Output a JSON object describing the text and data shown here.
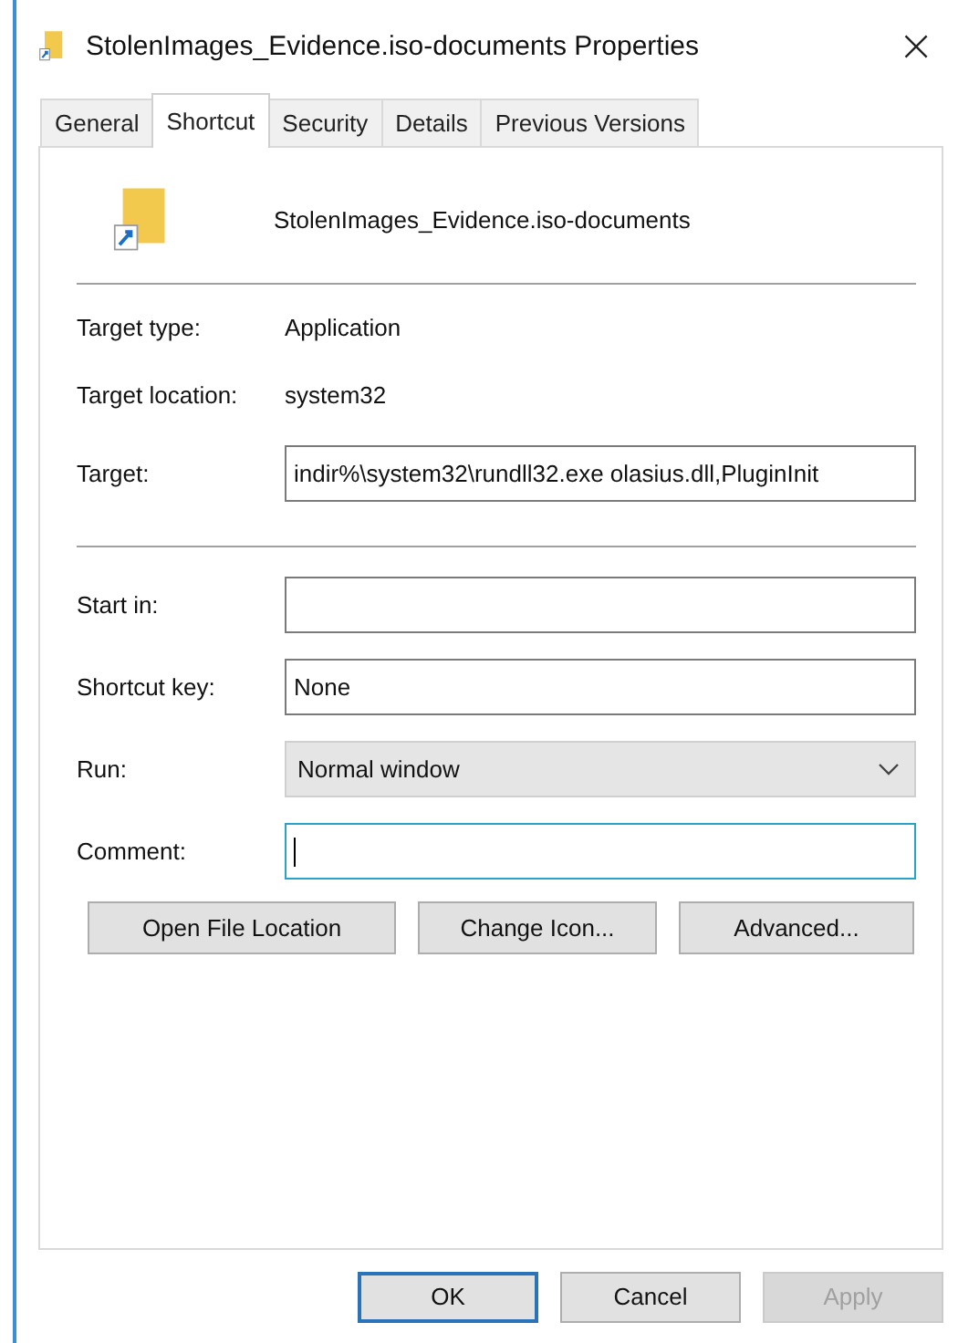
{
  "window": {
    "title": "StolenImages_Evidence.iso-documents Properties",
    "close": "×"
  },
  "tabs": [
    {
      "label": "General",
      "selected": false
    },
    {
      "label": "Shortcut",
      "selected": true
    },
    {
      "label": "Security",
      "selected": false
    },
    {
      "label": "Details",
      "selected": false
    },
    {
      "label": "Previous Versions",
      "selected": false
    }
  ],
  "shortcut_name": "StolenImages_Evidence.iso-documents",
  "info": [
    {
      "label": "Target type:",
      "value": "Application"
    },
    {
      "label": "Target location:",
      "value": "system32"
    }
  ],
  "target": {
    "label": "Target:",
    "value": "indir%\\system32\\rundll32.exe olasius.dll,PluginInit"
  },
  "fields": [
    {
      "kind": "text",
      "label": "Start in:",
      "focused": false
    },
    {
      "kind": "text",
      "label": "Shortcut key:",
      "value": "None",
      "focused": false
    },
    {
      "kind": "dropdown",
      "label": "Run:",
      "value": "Normal window",
      "focused": false
    },
    {
      "kind": "text",
      "label": "Comment:",
      "focused": true
    }
  ],
  "actions": [
    "Open File Location",
    "Change Icon...",
    "Advanced..."
  ],
  "dialog_buttons": [
    {
      "label": "OK",
      "default": true,
      "disabled": false
    },
    {
      "label": "Cancel",
      "default": false,
      "disabled": false
    },
    {
      "label": "Apply",
      "default": false,
      "disabled": true
    }
  ]
}
